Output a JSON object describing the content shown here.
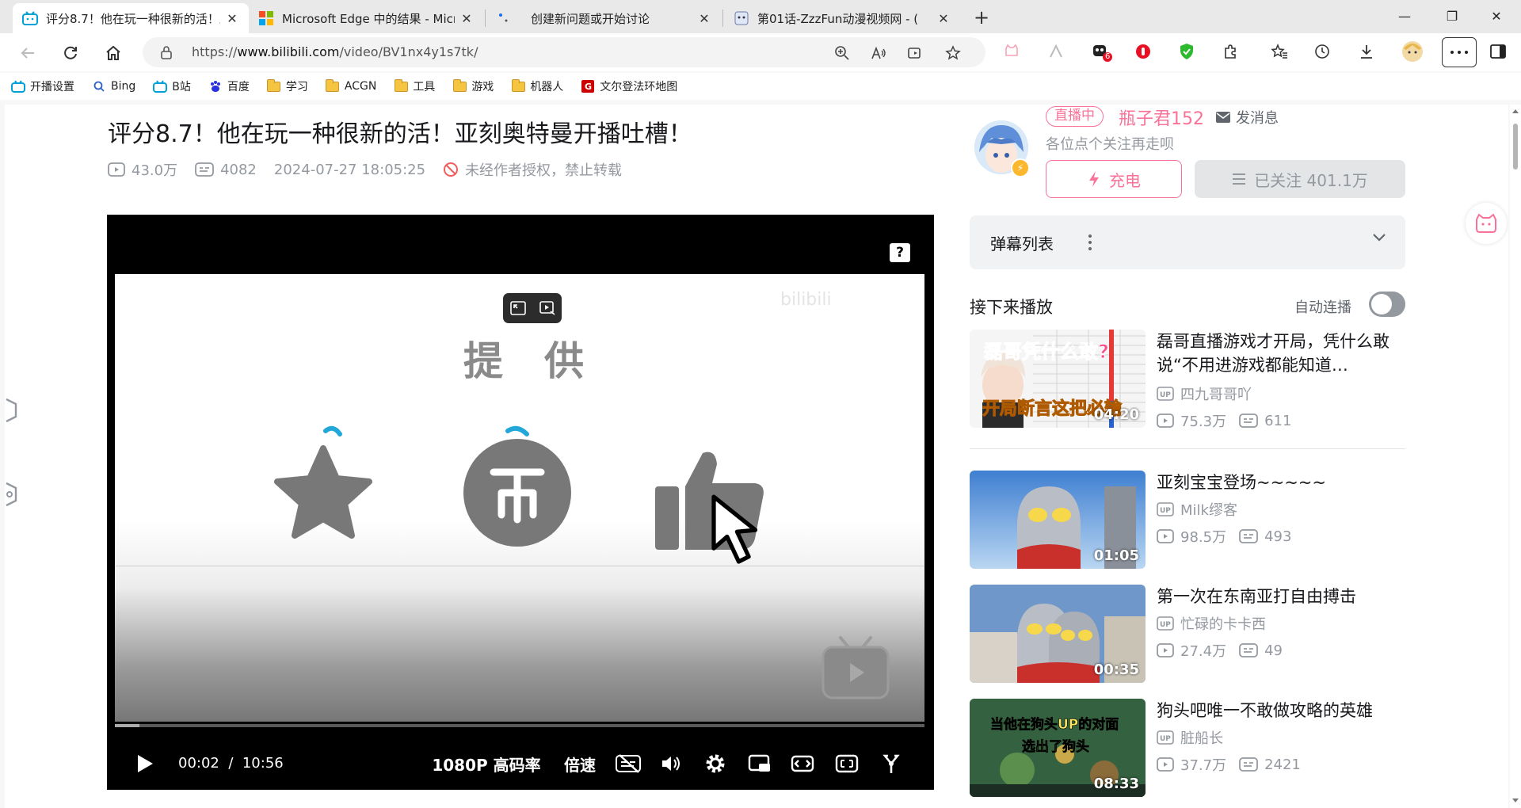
{
  "browser": {
    "tabs": [
      {
        "title": "评分8.7！他在玩一种很新的活！亚",
        "active": true,
        "icon": "bilibili-icon"
      },
      {
        "title": "Microsoft Edge 中的结果 - Micro",
        "active": false,
        "icon": "microsoft-icon"
      },
      {
        "title": "创建新问题或开始讨论",
        "active": false,
        "icon": "github-icon"
      },
      {
        "title": "第01话-ZzzFun动漫视频网 - (",
        "active": false,
        "icon": "anime-site-icon"
      }
    ],
    "close_glyph": "✕",
    "new_tab_glyph": "+",
    "window": {
      "minimize": "—",
      "restore": "❐",
      "close": "✕"
    },
    "url_prefix": "https://",
    "url_host": "www.bilibili.com",
    "url_path": "/video/BV1nx4y1s7tk/",
    "extension_badge": "6"
  },
  "bookmarks": [
    {
      "label": "开播设置",
      "icon": "bilibili-icon"
    },
    {
      "label": "Bing",
      "icon": "search-icon"
    },
    {
      "label": "B站",
      "icon": "bilibili-icon"
    },
    {
      "label": "百度",
      "icon": "baidu-icon"
    },
    {
      "label": "学习",
      "icon": "folder-icon"
    },
    {
      "label": "ACGN",
      "icon": "folder-icon"
    },
    {
      "label": "工具",
      "icon": "folder-icon"
    },
    {
      "label": "游戏",
      "icon": "folder-icon"
    },
    {
      "label": "机器人",
      "icon": "folder-icon"
    },
    {
      "label": "文尔登法环地图",
      "icon": "elden-ring-icon"
    }
  ],
  "video": {
    "title": "评分8.7！他在玩一种很新的活！亚刻奥特曼开播吐槽！",
    "views": "43.0万",
    "danmaku_count": "4082",
    "published": "2024-07-27 18:05:25",
    "copyright_notice": "未经作者授权，禁止转载"
  },
  "player": {
    "overlay_text": "提供",
    "watermark": "bilibili",
    "help_mark": "?",
    "current_time": "00:02",
    "time_separator": "/",
    "duration": "10:56",
    "progress": 0.004,
    "quality": "1080P 高码率",
    "speed": "倍速"
  },
  "uploader": {
    "live_badge": "直播中",
    "name": "瓶子君152",
    "message_label": "发消息",
    "description": "各位点个关注再走呗",
    "charge_label": "充电",
    "follow_label": "已关注 401.1万"
  },
  "danmaku_panel": {
    "title": "弹幕列表"
  },
  "next_up": {
    "title": "接下来播放",
    "autoplay_label": "自动连播",
    "autoplay_on": false
  },
  "recommendations": [
    {
      "title": "磊哥直播游戏才开局，凭什么敢说“不用进游戏都能知道…",
      "up": "四九哥哥吖",
      "views": "75.3万",
      "danmaku": "611",
      "duration": "04:20",
      "thumb_text_top": "磊哥凭什么敢?",
      "thumb_text_bottom": "开局断言这把必输"
    },
    {
      "title": "亚刻宝宝登场~~~~~",
      "up": "Milk缪客",
      "views": "98.5万",
      "danmaku": "493",
      "duration": "01:05"
    },
    {
      "title": "第一次在东南亚打自由搏击",
      "up": "忙碌的卡卡西",
      "views": "27.4万",
      "danmaku": "49",
      "duration": "00:35"
    },
    {
      "title": "狗头吧唯一不敢做攻略的英雄",
      "up": "脏船长",
      "views": "37.7万",
      "danmaku": "2421",
      "duration": "08:33",
      "thumb_text_top": "当他在狗头UP的对面",
      "thumb_text_bottom": "选出了狗头"
    }
  ],
  "colors": {
    "bilibili_pink": "#fb7299",
    "bilibili_blue": "#00a1d6",
    "text_secondary": "#9499a0"
  }
}
